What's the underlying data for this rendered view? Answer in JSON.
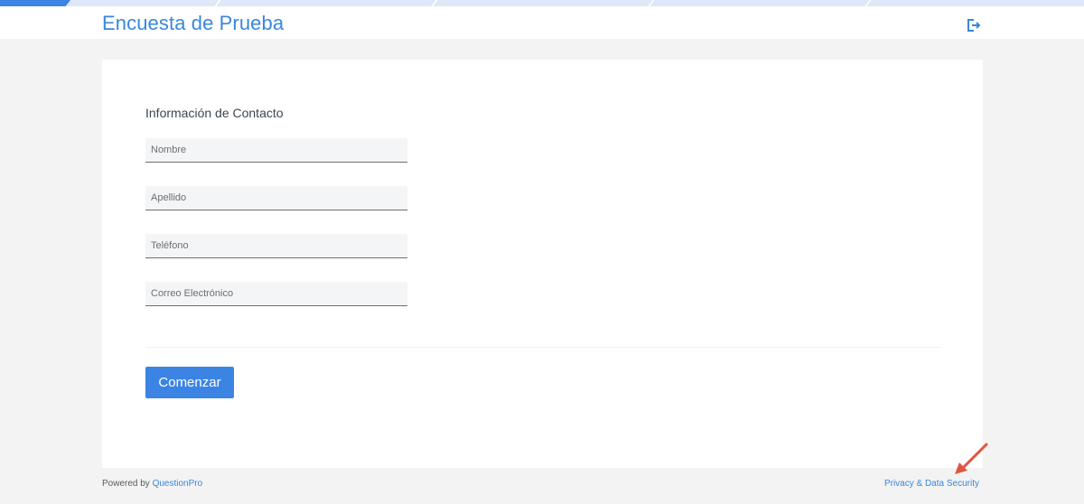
{
  "progress": {
    "fraction": 0.065
  },
  "header": {
    "title": "Encuesta de Prueba",
    "exit_icon": "exit-icon"
  },
  "form": {
    "section_label": "Información de Contacto",
    "fields": [
      {
        "placeholder": "Nombre",
        "value": ""
      },
      {
        "placeholder": "Apellido",
        "value": ""
      },
      {
        "placeholder": "Teléfono",
        "value": ""
      },
      {
        "placeholder": "Correo Electrónico",
        "value": ""
      }
    ],
    "start_button_label": "Comenzar"
  },
  "footer": {
    "powered_by_prefix": "Powered by",
    "brand_link": "QuestionPro",
    "privacy_link": "Privacy & Data Security"
  },
  "colors": {
    "accent": "#3b84e3",
    "title": "#3a86df",
    "annotation": "#e2553f"
  },
  "annotation": {
    "icon": "red-arrow-icon"
  }
}
